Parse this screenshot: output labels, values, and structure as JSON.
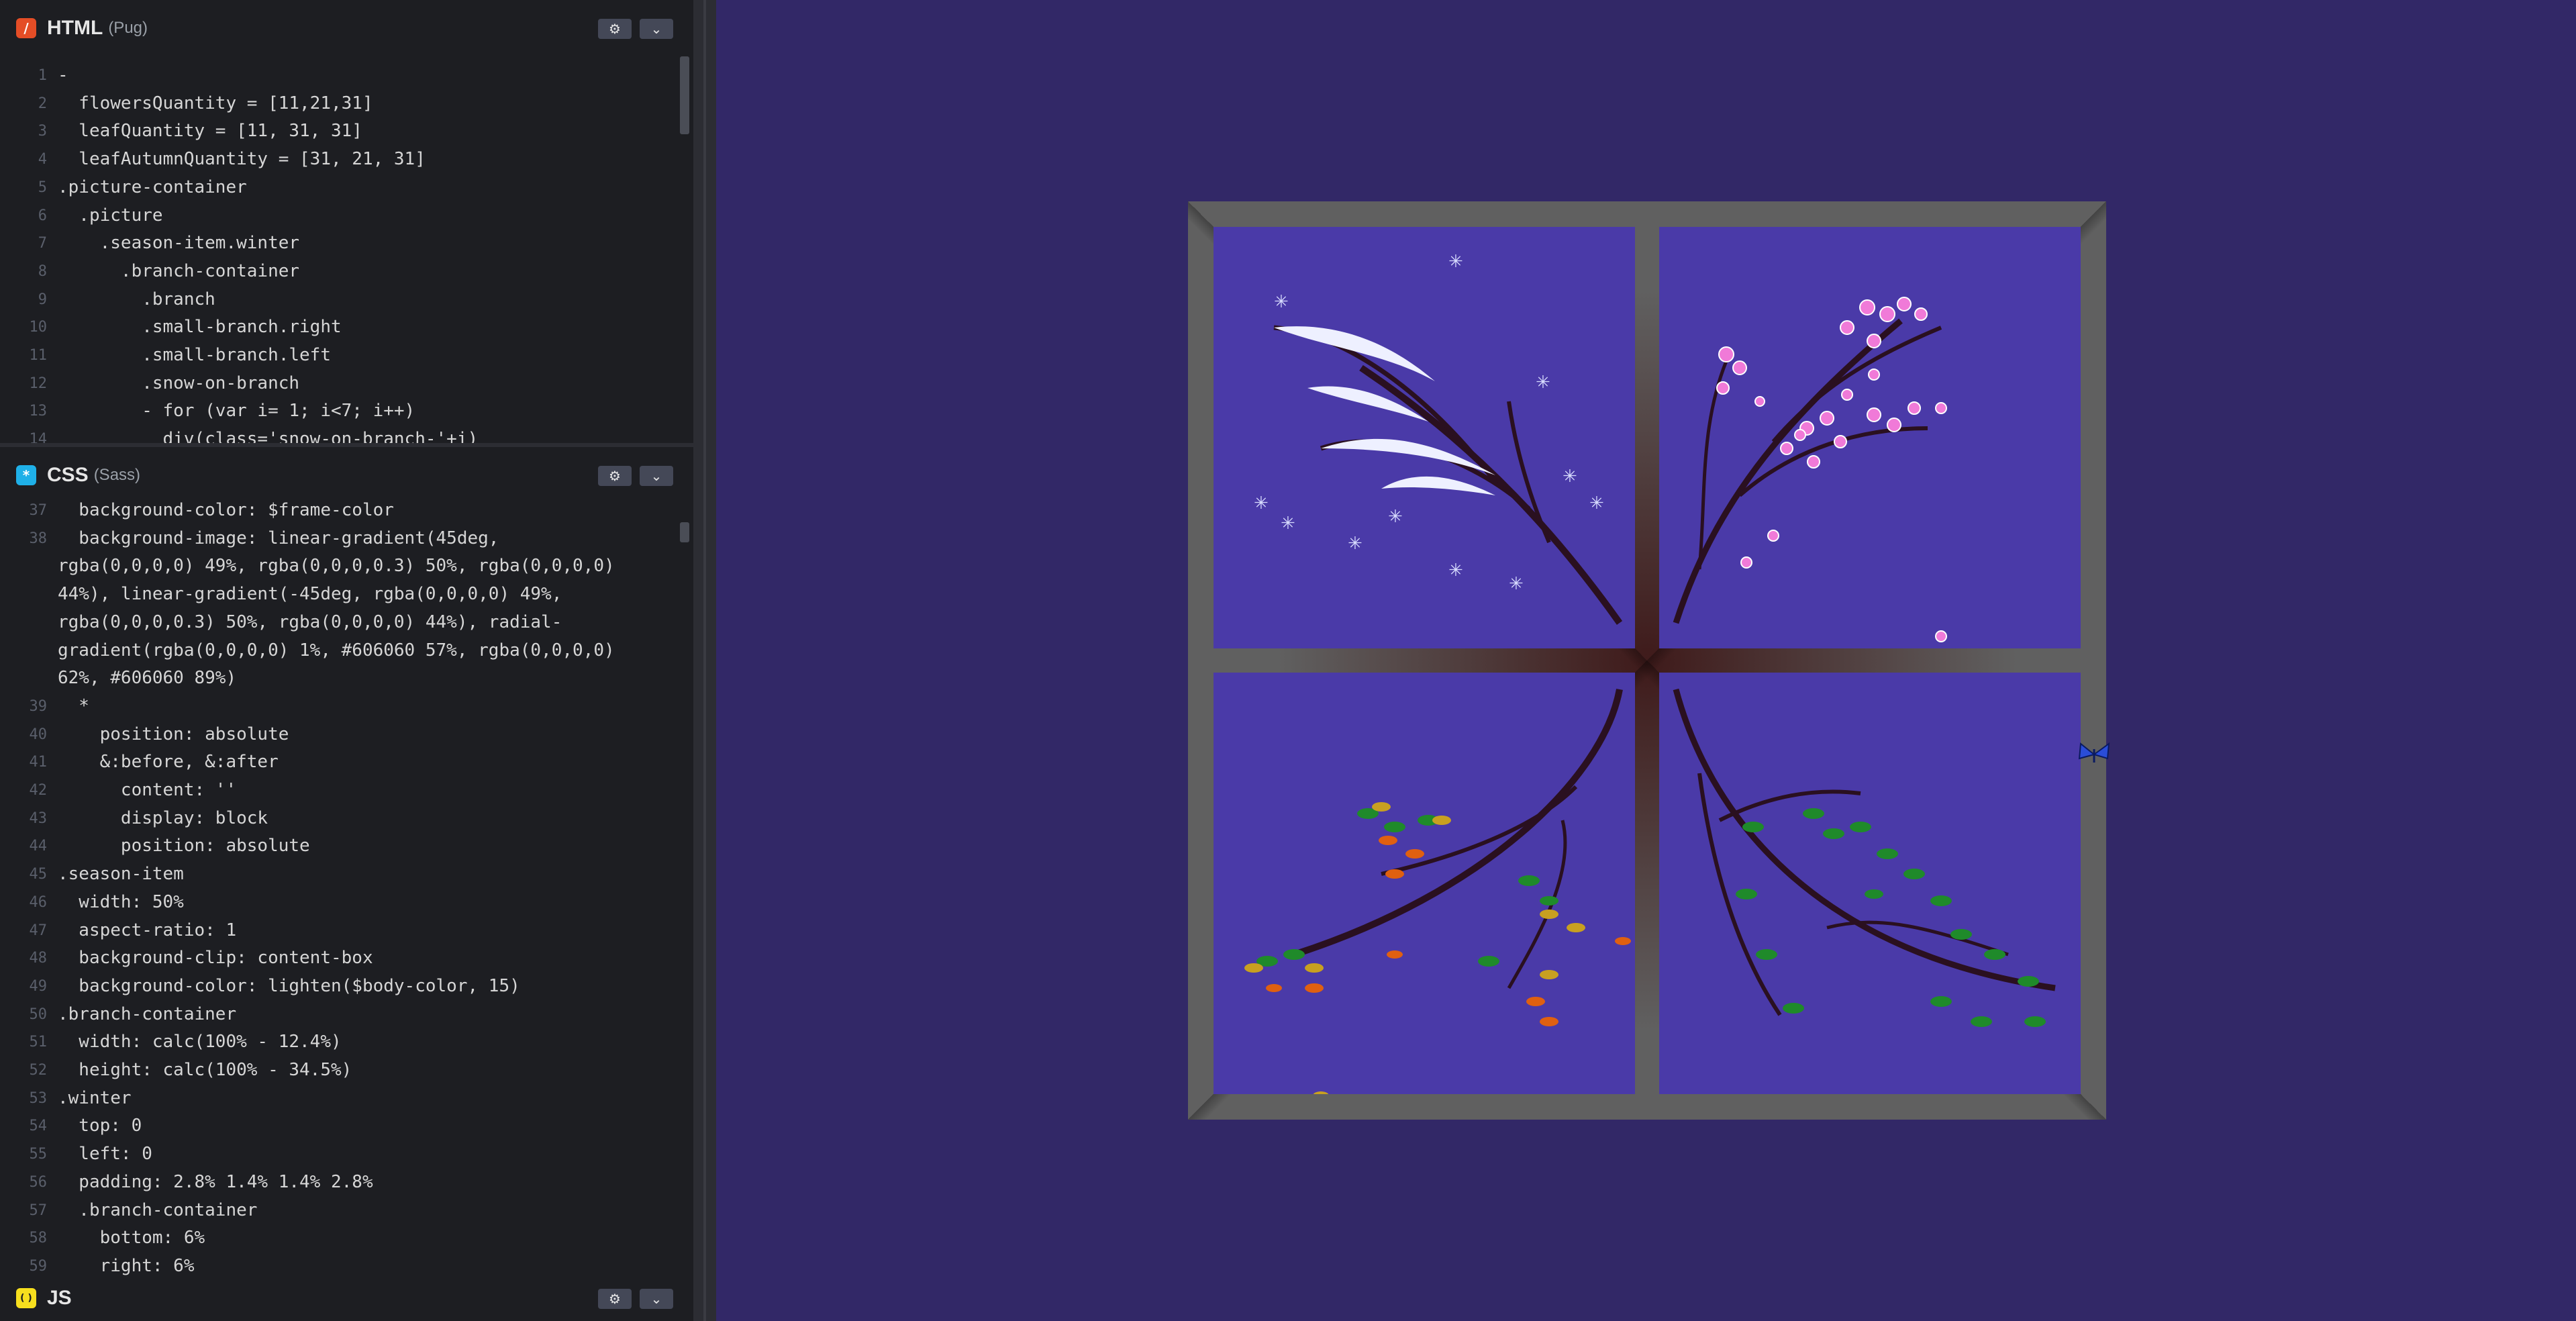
{
  "html_panel": {
    "title": "HTML",
    "preprocessor": "(Pug)",
    "badge": "/",
    "settings_icon": "⚙",
    "collapse_icon": "⌄",
    "lines": [
      {
        "n": "1",
        "t": "-"
      },
      {
        "n": "2",
        "t": "  flowersQuantity = [11,21,31]"
      },
      {
        "n": "3",
        "t": "  leafQuantity = [11, 31, 31]"
      },
      {
        "n": "4",
        "t": "  leafAutumnQuantity = [31, 21, 31]"
      },
      {
        "n": "5",
        "t": ".picture-container"
      },
      {
        "n": "6",
        "t": "  .picture"
      },
      {
        "n": "7",
        "t": "    .season-item.winter"
      },
      {
        "n": "8",
        "t": "      .branch-container"
      },
      {
        "n": "9",
        "t": "        .branch"
      },
      {
        "n": "10",
        "t": "        .small-branch.right"
      },
      {
        "n": "11",
        "t": "        .small-branch.left"
      },
      {
        "n": "12",
        "t": "        .snow-on-branch"
      },
      {
        "n": "13",
        "t": "        - for (var i= 1; i<7; i++)"
      },
      {
        "n": "14",
        "t": "          div(class='snow-on-branch-'+i)"
      }
    ]
  },
  "css_panel": {
    "title": "CSS",
    "preprocessor": "(Sass)",
    "badge": "*",
    "settings_icon": "⚙",
    "collapse_icon": "⌄",
    "lines": [
      {
        "n": "37",
        "t": "  background-color: $frame-color"
      },
      {
        "n": "38",
        "t": "  background-image: linear-gradient(45deg,"
      },
      {
        "n": "",
        "t": "rgba(0,0,0,0) 49%, rgba(0,0,0,0.3) 50%, rgba(0,0,0,0)"
      },
      {
        "n": "",
        "t": "44%), linear-gradient(-45deg, rgba(0,0,0,0) 49%,"
      },
      {
        "n": "",
        "t": "rgba(0,0,0,0.3) 50%, rgba(0,0,0,0) 44%), radial-"
      },
      {
        "n": "",
        "t": "gradient(rgba(0,0,0,0) 1%, #606060 57%, rgba(0,0,0,0)"
      },
      {
        "n": "",
        "t": "62%, #606060 89%)"
      },
      {
        "n": "39",
        "t": "  *"
      },
      {
        "n": "40",
        "t": "    position: absolute"
      },
      {
        "n": "41",
        "t": "    &:before, &:after"
      },
      {
        "n": "42",
        "t": "      content: ''"
      },
      {
        "n": "43",
        "t": "      display: block"
      },
      {
        "n": "44",
        "t": "      position: absolute"
      },
      {
        "n": "45",
        "t": ".season-item"
      },
      {
        "n": "46",
        "t": "  width: 50%"
      },
      {
        "n": "47",
        "t": "  aspect-ratio: 1"
      },
      {
        "n": "48",
        "t": "  background-clip: content-box"
      },
      {
        "n": "49",
        "t": "  background-color: lighten($body-color, 15)"
      },
      {
        "n": "50",
        "t": ".branch-container"
      },
      {
        "n": "51",
        "t": "  width: calc(100% - 12.4%)"
      },
      {
        "n": "52",
        "t": "  height: calc(100% - 34.5%)"
      },
      {
        "n": "53",
        "t": ".winter"
      },
      {
        "n": "54",
        "t": "  top: 0"
      },
      {
        "n": "55",
        "t": "  left: 0"
      },
      {
        "n": "56",
        "t": "  padding: 2.8% 1.4% 1.4% 2.8%"
      },
      {
        "n": "57",
        "t": "  .branch-container"
      },
      {
        "n": "58",
        "t": "    bottom: 6%"
      },
      {
        "n": "59",
        "t": "    right: 6%"
      }
    ]
  },
  "js_panel": {
    "title": "JS",
    "badge": "( )",
    "settings_icon": "⚙",
    "collapse_icon": "⌄"
  },
  "colors": {
    "result_bg": "#322867",
    "pane_bg": "#4a3aa8",
    "frame": "#606060",
    "html_badge": "#e44d26",
    "css_badge": "#1fb0e8",
    "js_badge": "#f7df1e",
    "branch": "#2a1020",
    "blossom": "#f07ad8",
    "leaf_green": "#1f8a2a",
    "leaf_orange": "#e06010",
    "leaf_gold": "#c8a020"
  },
  "artwork": {
    "window_frame_icon": "window-frame",
    "panes": [
      "winter",
      "spring",
      "autumn",
      "summer"
    ],
    "butterfly_icon": "butterfly-icon"
  }
}
